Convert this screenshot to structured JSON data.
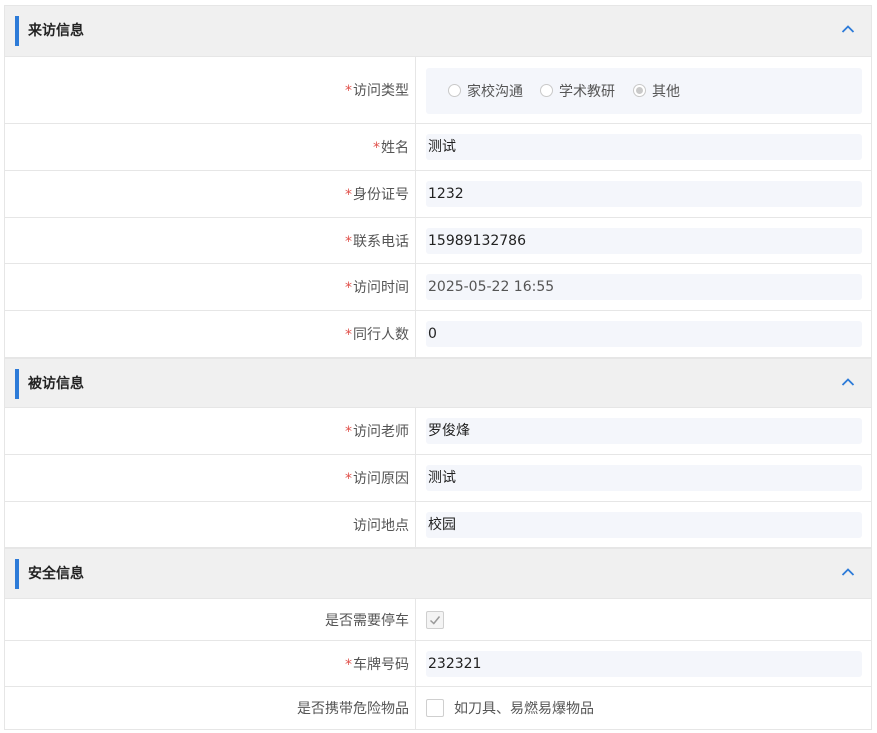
{
  "sections": {
    "visitor": {
      "title": "来访信息"
    },
    "host": {
      "title": "被访信息"
    },
    "safety": {
      "title": "安全信息"
    }
  },
  "required_mark": "*",
  "visitor": {
    "visit_type": {
      "label": "访问类型",
      "options": [
        "家校沟通",
        "学术教研",
        "其他"
      ],
      "selected": "其他"
    },
    "name": {
      "label": "姓名",
      "value": "测试"
    },
    "id_number": {
      "label": "身份证号",
      "value": "1232"
    },
    "phone": {
      "label": "联系电话",
      "value": "15989132786"
    },
    "visit_time": {
      "label": "访问时间",
      "value": "2025-05-22 16:55"
    },
    "companions": {
      "label": "同行人数",
      "value": "0"
    }
  },
  "host": {
    "teacher": {
      "label": "访问老师",
      "value": "罗俊烽"
    },
    "reason": {
      "label": "访问原因",
      "value": "测试"
    },
    "location": {
      "label": "访问地点",
      "value": "校园"
    }
  },
  "safety": {
    "parking": {
      "label": "是否需要停车",
      "checked": true
    },
    "plate": {
      "label": "车牌号码",
      "value": "232321"
    },
    "dangerous": {
      "label": "是否携带危险物品",
      "option_text": "如刀具、易燃易爆物品",
      "checked": false
    }
  },
  "colors": {
    "accent": "#2d7bd8",
    "required": "#e0504a",
    "header_bg": "#f0f0f0",
    "field_bg": "#f4f6fb"
  }
}
